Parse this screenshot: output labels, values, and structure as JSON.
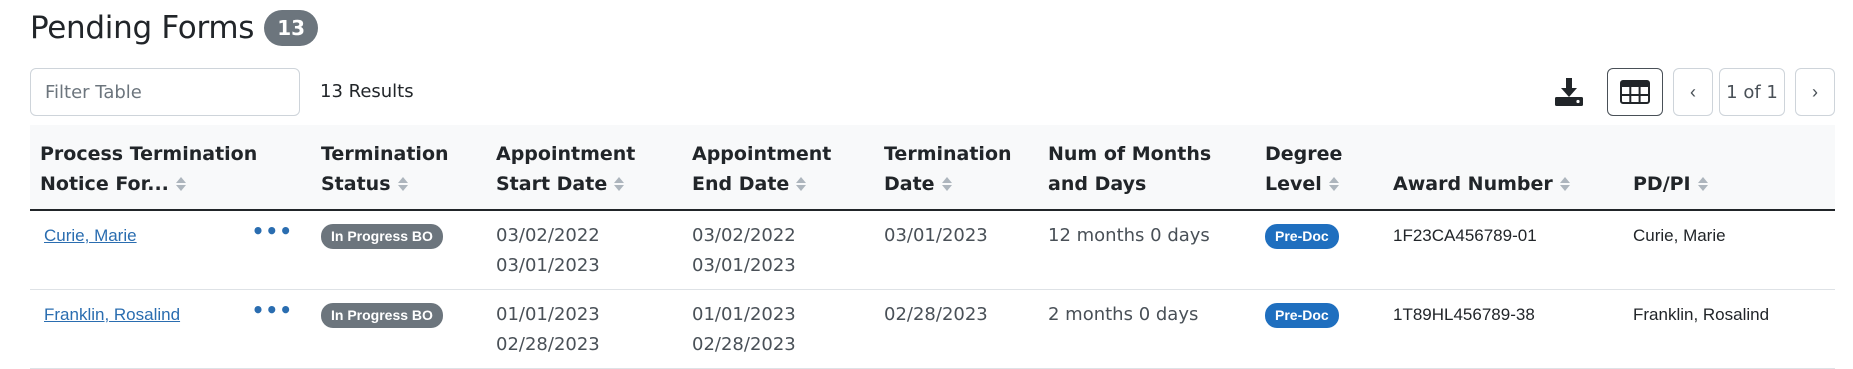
{
  "page": {
    "title": "Pending Forms",
    "count": "13"
  },
  "toolbar": {
    "filter_placeholder": "Filter Table",
    "results": "13 Results",
    "pagination": {
      "prev": "‹",
      "indicator": "1 of 1",
      "next": "›"
    },
    "icons": {
      "download": "download-icon",
      "grid": "table-grid-icon"
    }
  },
  "table": {
    "headers": [
      {
        "label": "Process Termination Notice For..."
      },
      {
        "label": "Termination Status"
      },
      {
        "label": "Appointment Start Date"
      },
      {
        "label": "Appointment End Date"
      },
      {
        "label": "Termination Date"
      },
      {
        "label": "Num of Months and Days"
      },
      {
        "label": "Degree Level"
      },
      {
        "label": "Award Number"
      },
      {
        "label": "PD/PI"
      }
    ],
    "rows": [
      {
        "name": "Curie, Marie ",
        "more": "•••",
        "status": "In Progress BO",
        "start_1": "03/02/2022",
        "start_2": "03/01/2023",
        "end_1": "03/02/2022",
        "end_2": "03/01/2023",
        "termination_date": "03/01/2023",
        "duration": "12 months 0 days",
        "degree_level": "Pre-Doc",
        "award_number": "1F23CA456789-01",
        "pd_pi": "Curie, Marie"
      },
      {
        "name": "Franklin, Rosalind",
        "more": "•••",
        "status": "In Progress BO",
        "start_1": "01/01/2023",
        "start_2": "02/28/2023",
        "end_1": "01/01/2023",
        "end_2": "02/28/2023",
        "termination_date": "02/28/2023",
        "duration": "2 months 0 days",
        "degree_level": "Pre-Doc",
        "award_number": "1T89HL456789-38",
        "pd_pi": "Franklin, Rosalind"
      }
    ]
  },
  "colors": {
    "link": "#2a6db0",
    "status_badge": "#6c757d",
    "degree_badge": "#1f6fbf",
    "count_badge": "#6c757d"
  }
}
